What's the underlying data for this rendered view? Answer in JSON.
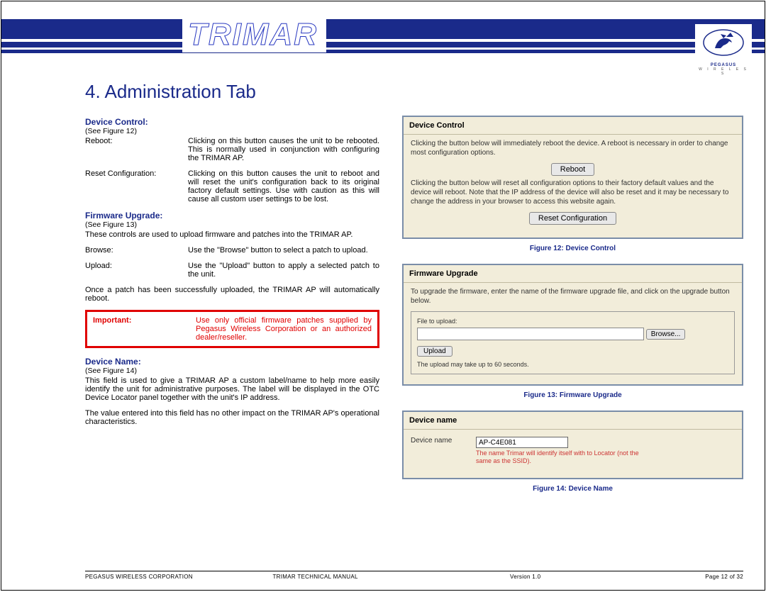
{
  "brand": "TRIMAR",
  "logo": {
    "name": "PEGASUS",
    "sub": "W I R E L E S S"
  },
  "title": "4. Administration Tab",
  "sections": {
    "device_control": {
      "heading": "Device Control:",
      "see": "(See Figure 12)",
      "items": [
        {
          "label": "Reboot:",
          "text": "Clicking on this button causes the unit to be rebooted. This is normally used in conjunction with configuring the TRIMAR AP."
        },
        {
          "label": "Reset Configuration:",
          "text": "Clicking on this button causes the unit to reboot and will reset the unit's configuration back to its original factory default settings. Use with caution as this will cause all custom user settings to be lost."
        }
      ]
    },
    "firmware": {
      "heading": "Firmware Upgrade:",
      "see": "(See Figure 13)",
      "intro": "These controls are used to upload firmware and patches into the TRIMAR AP.",
      "items": [
        {
          "label": "Browse:",
          "text": "Use the \"Browse\" button to select a patch to upload."
        },
        {
          "label": "Upload:",
          "text": "Use the \"Upload\" button to apply a selected patch to the unit."
        }
      ],
      "outro": "Once a patch has been successfully uploaded, the TRIMAR AP will automatically reboot.",
      "important_label": "Important:",
      "important_text": "Use only official firmware patches supplied by Pegasus Wireless Corporation or an authorized dealer/reseller."
    },
    "device_name": {
      "heading": "Device Name:",
      "see": "(See Figure 14)",
      "p1": "This field is used to give a TRIMAR AP a custom label/name to help more easily identify the unit for administrative purposes. The label will be displayed in the OTC Device Locator panel together with the unit's IP address.",
      "p2": "The value entered into this field has no other impact on the TRIMAR AP's operational characteristics."
    }
  },
  "panels": {
    "dc": {
      "title": "Device Control",
      "p1": "Clicking the button below will immediately reboot the device. A reboot is necessary in order to change most configuration options.",
      "btn1": "Reboot",
      "p2": "Clicking the button below will reset all configuration options to their factory default values and the device will reboot. Note that the IP address of the device will also be reset and it may be necessary to change the address in your browser to access this website again.",
      "btn2": "Reset Configuration",
      "caption": "Figure 12: Device Control"
    },
    "fw": {
      "title": "Firmware Upgrade",
      "p1": "To upgrade the firmware, enter the name of the firmware upgrade file, and click on the upgrade button below.",
      "file_label": "File to upload:",
      "browse": "Browse...",
      "upload": "Upload",
      "note": "The upload may take up to 60 seconds.",
      "caption": "Figure 13: Firmware Upgrade"
    },
    "dn": {
      "title": "Device name",
      "label": "Device name",
      "value": "AP-C4E081",
      "hint": "The name Trimar will identify itself with to Locator (not the same as the SSID).",
      "caption": "Figure 14: Device Name"
    }
  },
  "footer": {
    "left": "PEGASUS WIRELESS CORPORATION",
    "center": "TRIMAR TECHNICAL MANUAL",
    "version": "Version 1.0",
    "page": "Page 12 of 32"
  }
}
